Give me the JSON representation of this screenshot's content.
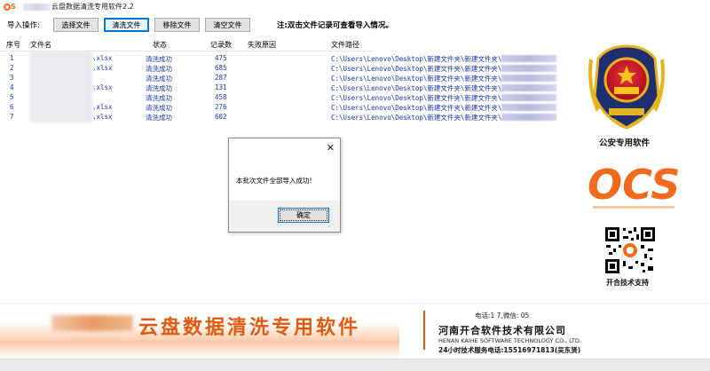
{
  "window": {
    "title": "云盘数据清洗专用软件2.2"
  },
  "toolbar": {
    "label": "导入操作:",
    "buttons": [
      "选择文件",
      "清洗文件",
      "移除文件",
      "清空文件"
    ],
    "note": "注:双击文件记录可查看导入情况。"
  },
  "table": {
    "headers": [
      "序号",
      "文件名",
      "状态",
      "记录数",
      "失败原因",
      "文件路径"
    ],
    "rows": [
      {
        "idx": "1",
        "name": ".xlsx",
        "status": "清洗成功",
        "count": "475",
        "path": "C:\\Users\\Lenovo\\Desktop\\新建文件夹\\新建文件夹\\"
      },
      {
        "idx": "2",
        "name": ".xlsx",
        "status": "清洗成功",
        "count": "685",
        "path": "C:\\Users\\Lenovo\\Desktop\\新建文件夹\\新建文件夹\\"
      },
      {
        "idx": "3",
        "name": "",
        "status": "清洗成功",
        "count": "287",
        "path": "C:\\Users\\Lenovo\\Desktop\\新建文件夹\\新建文件夹\\"
      },
      {
        "idx": "4",
        "name": ".xlsx",
        "status": "清洗成功",
        "count": "131",
        "path": "C:\\Users\\Lenovo\\Desktop\\新建文件夹\\新建文件夹\\"
      },
      {
        "idx": "5",
        "name": "",
        "status": "清洗成功",
        "count": "458",
        "path": "C:\\Users\\Lenovo\\Desktop\\新建文件夹\\新建文件夹\\"
      },
      {
        "idx": "6",
        "name": ".xlsx",
        "status": "清洗成功",
        "count": "276",
        "path": "C:\\Users\\Lenovo\\Desktop\\新建文件夹\\新建文件夹\\"
      },
      {
        "idx": "7",
        "name": ".xlsx",
        "status": "清洗成功",
        "count": "602",
        "path": "C:\\Users\\Lenovo\\Desktop\\新建文件夹\\新建文件夹\\"
      }
    ]
  },
  "logos": {
    "police_label": "公安专用软件",
    "ocs_text": "OCS",
    "qr_label": "开合技术支持"
  },
  "dialog": {
    "close": "✕",
    "message": "本批次文件全部导入成功!",
    "ok": "确定"
  },
  "banner": {
    "title": "云盘数据清洗专用软件",
    "contact": "电话:1          7,微信:          05",
    "company_cn": "河南开合软件技术有限公司",
    "company_en": "HENAN KAIHE SOFTWARE TECHNOLOGY CO., LTD.",
    "support": "24小时技术服务电话:15516971813(吴东贤)"
  },
  "colors": {
    "accent": "#e25a0e",
    "link_blue": "#1a34a8",
    "police_red": "#c8102e",
    "police_gold": "#e8b320"
  }
}
